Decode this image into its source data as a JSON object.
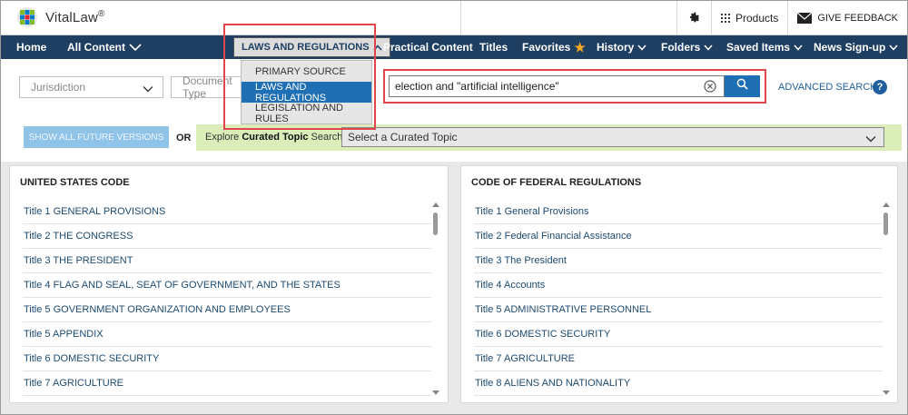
{
  "app": {
    "logo_text": "VitalLaw",
    "logo_reg": "®"
  },
  "topbar": {
    "products_label": "Products",
    "feedback_label": "GIVE FEEDBACK"
  },
  "nav": {
    "items": [
      {
        "label": "Home"
      },
      {
        "label": "All Content"
      },
      {
        "label": "LAWS AND REGULATIONS"
      },
      {
        "label": "Practical Content"
      },
      {
        "label": "Titles"
      },
      {
        "label": "Favorites"
      },
      {
        "label": "History"
      },
      {
        "label": "Folders"
      },
      {
        "label": "Saved Items"
      },
      {
        "label": "News Sign-up"
      }
    ]
  },
  "dropdown": {
    "items": [
      {
        "label": "PRIMARY SOURCE"
      },
      {
        "label": "LAWS AND REGULATIONS"
      },
      {
        "label": "LEGISLATION AND RULES"
      }
    ],
    "selected": "LAWS AND REGULATIONS"
  },
  "search": {
    "jurisdiction_placeholder": "Jurisdiction",
    "doctype_placeholder": "Document Type",
    "query": "election and \"artificial intelligence\"",
    "advanced_label": "ADVANCED SEARCH",
    "help_label": "?"
  },
  "future_versions_label": "SHOW ALL FUTURE VERSIONS",
  "or_label": "OR",
  "curated": {
    "prefix": "Explore ",
    "bold": "Curated Topic",
    "suffix": " Search",
    "select_placeholder": "Select a Curated Topic"
  },
  "panels": {
    "usc": {
      "title": "UNITED STATES CODE",
      "rows": [
        "Title 1 GENERAL PROVISIONS",
        "Title 2 THE CONGRESS",
        "Title 3 THE PRESIDENT",
        "Title 4 FLAG AND SEAL, SEAT OF GOVERNMENT, AND THE STATES",
        "Title 5 GOVERNMENT ORGANIZATION AND EMPLOYEES",
        "Title 5 APPENDIX",
        "Title 6 DOMESTIC SECURITY",
        "Title 7 AGRICULTURE"
      ]
    },
    "cfr": {
      "title": "CODE OF FEDERAL REGULATIONS",
      "rows": [
        "Title 1 General Provisions",
        "Title 2 Federal Financial Assistance",
        "Title 3 The President",
        "Title 4 Accounts",
        "Title 5 ADMINISTRATIVE PERSONNEL",
        "Title 6 DOMESTIC SECURITY",
        "Title 7 AGRICULTURE",
        "Title 8 ALIENS AND NATIONALITY"
      ]
    }
  },
  "colors": {
    "nav_bg": "#1e3f62",
    "accent_blue": "#1f6fb5",
    "highlight_red": "#e0474c",
    "curated_bg": "#dbeeb9"
  }
}
